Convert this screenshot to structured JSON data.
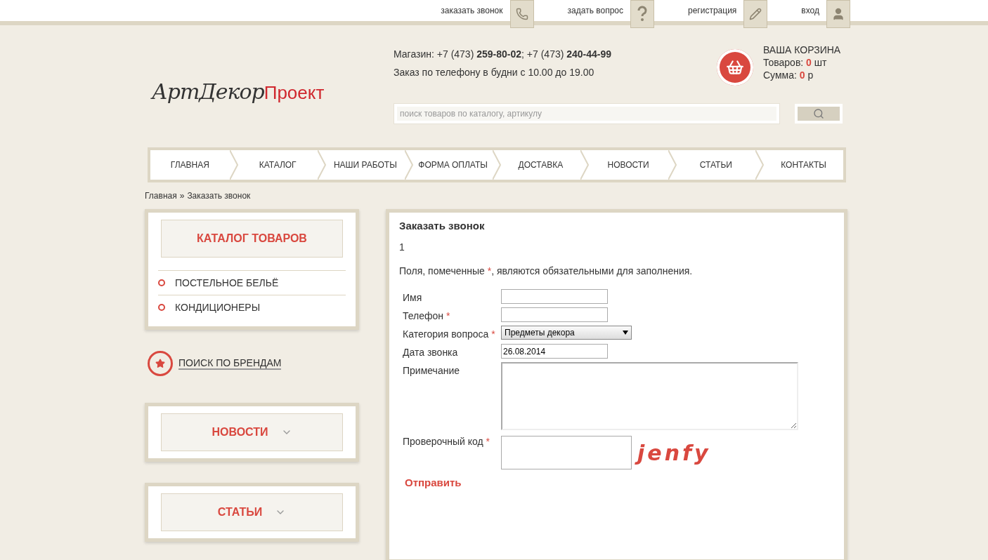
{
  "top_bar": [
    {
      "label": "заказать звонок"
    },
    {
      "label": "задать вопрос"
    },
    {
      "label": "регистрация"
    },
    {
      "label": "вход"
    }
  ],
  "logo": {
    "script": "АртДекор",
    "word": "Проект"
  },
  "contacts": {
    "phones": "Магазин: +7 (473) **259-80-02**; +7 (473) **240-44-99**",
    "hours": "Заказ по телефону в будни с 10.00 до 19.00"
  },
  "cart": {
    "title": "ВАША КОРЗИНА",
    "items": "Товаров: **0** шт",
    "sum": "Сумма: **0** р"
  },
  "search": {
    "placeholder": "поиск товаров по каталогу, артикулу"
  },
  "nav": [
    {
      "label": "ГЛАВНАЯ"
    },
    {
      "label": "КАТАЛОГ"
    },
    {
      "label": "НАШИ РАБОТЫ"
    },
    {
      "label": "ФОРМА ОПЛАТЫ"
    },
    {
      "label": "ДОСТАВКА"
    },
    {
      "label": "НОВОСТИ"
    },
    {
      "label": "СТАТЬИ"
    },
    {
      "label": "КОНТАКТЫ"
    }
  ],
  "breadcrumb": {
    "links": [
      "Главная"
    ],
    "separator": "»",
    "current": "Заказать звонок"
  },
  "sidebar": {
    "catalog": {
      "title": "КАТАЛОГ ТОВАРОВ",
      "items": [
        "ПОСТЕЛЬНОЕ БЕЛЬЁ",
        "КОНДИЦИОНЕРЫ"
      ]
    },
    "brands_link": "ПОИСК ПО БРЕНДАМ",
    "panels": [
      {
        "title": "НОВОСТИ",
        "expanded": false
      },
      {
        "title": "СТАТЬИ",
        "expanded": false
      }
    ]
  },
  "form": {
    "title": "Заказать звонок",
    "counter": "1",
    "required_mark": "*",
    "notice": {
      "before": "Поля, помеченные ",
      "after": ", являются обязательными для заполнения."
    },
    "fields": [
      {
        "kind": "text",
        "label": "Имя",
        "required": false
      },
      {
        "kind": "text",
        "label": "Телефон",
        "required": true
      },
      {
        "kind": "select",
        "label": "Категория вопроса",
        "required": true,
        "value": "Предметы декора"
      },
      {
        "kind": "text",
        "label": "Дата звонка",
        "required": false,
        "value": "26.08.2014"
      },
      {
        "kind": "textarea",
        "label": "Примечание",
        "required": false
      },
      {
        "kind": "captcha",
        "label": "Проверочный код",
        "required": true,
        "code": "jenfy"
      }
    ],
    "submit": "Отправить"
  }
}
